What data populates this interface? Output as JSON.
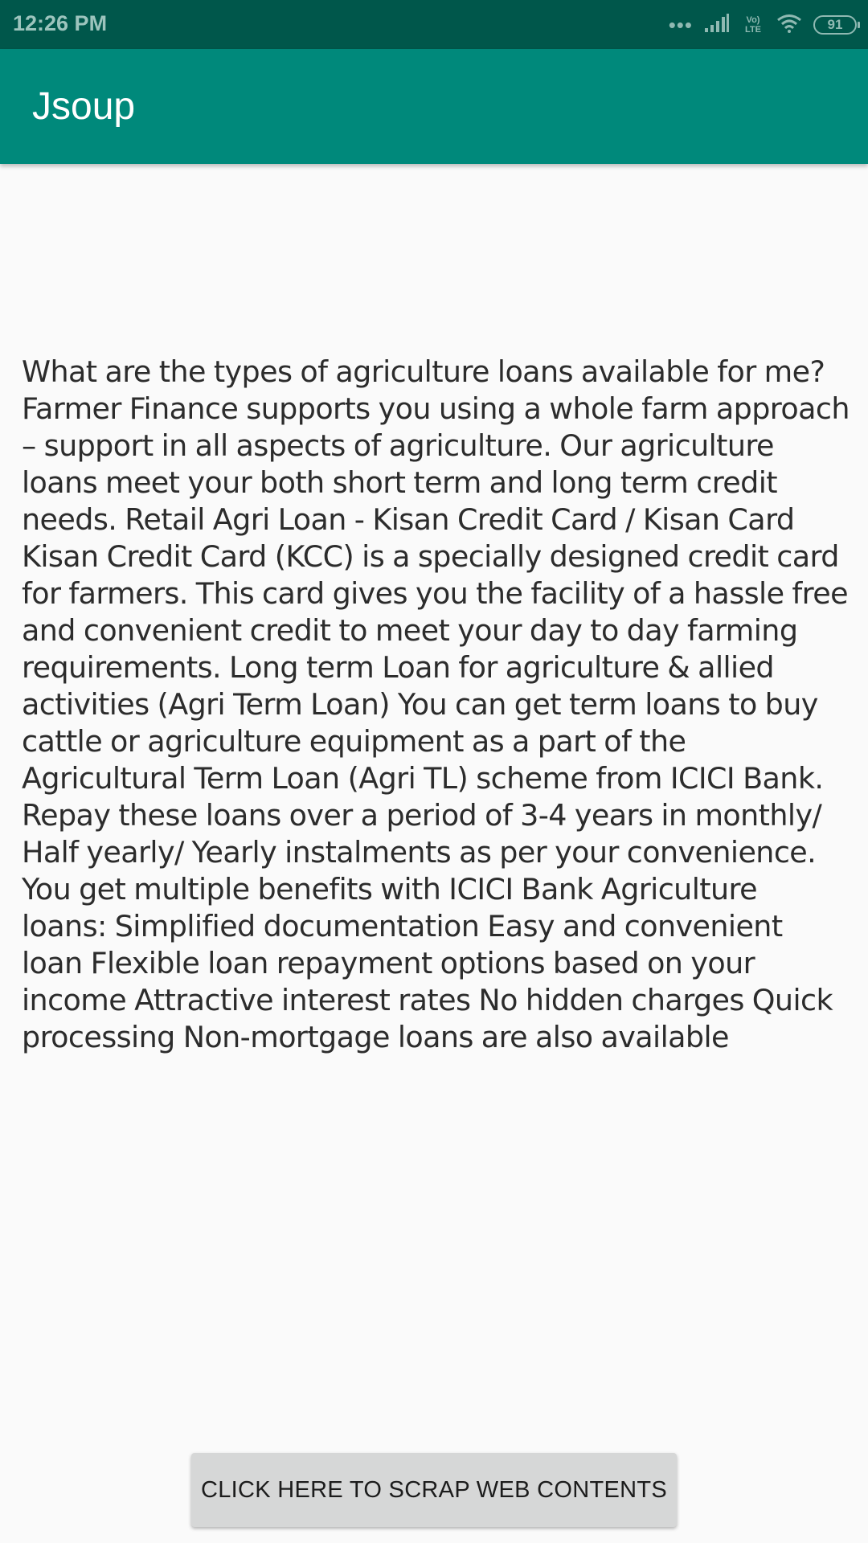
{
  "status_bar": {
    "time": "12:26 PM",
    "network_label": "Vo) LTE",
    "battery_level": "91",
    "icons": [
      "dots-icon",
      "signal-icon",
      "volte-icon",
      "wifi-icon",
      "battery-icon"
    ]
  },
  "app_bar": {
    "title": "Jsoup",
    "color": "#00897b",
    "status_color": "#00574b"
  },
  "content": {
    "text": "What are the types of agriculture loans available for me? Farmer Finance supports you using a whole farm approach – support in all aspects of agriculture. Our agriculture loans meet your both short term and long term credit needs. Retail Agri Loan - Kisan Credit Card / Kisan Card Kisan Credit Card (KCC) is a specially designed credit card for farmers. This card gives you the facility of a hassle free and convenient credit to meet your day to day farming requirements. Long term Loan for agriculture & allied activities (Agri Term Loan) You can get term loans to buy cattle or agriculture equipment as a part of the Agricultural Term Loan (Agri TL) scheme from ICICI Bank. Repay these loans over a period of 3-4 years in monthly/ Half yearly/ Yearly instalments as per your convenience. You get multiple benefits with ICICI Bank Agriculture loans: Simplified documentation Easy and convenient loan Flexible loan repayment options based on your income Attractive interest rates No hidden charges Quick processing Non-mortgage loans are also available"
  },
  "actions": {
    "scrap_button_label": "CLICK HERE TO SCRAP WEB CONTENTS"
  }
}
